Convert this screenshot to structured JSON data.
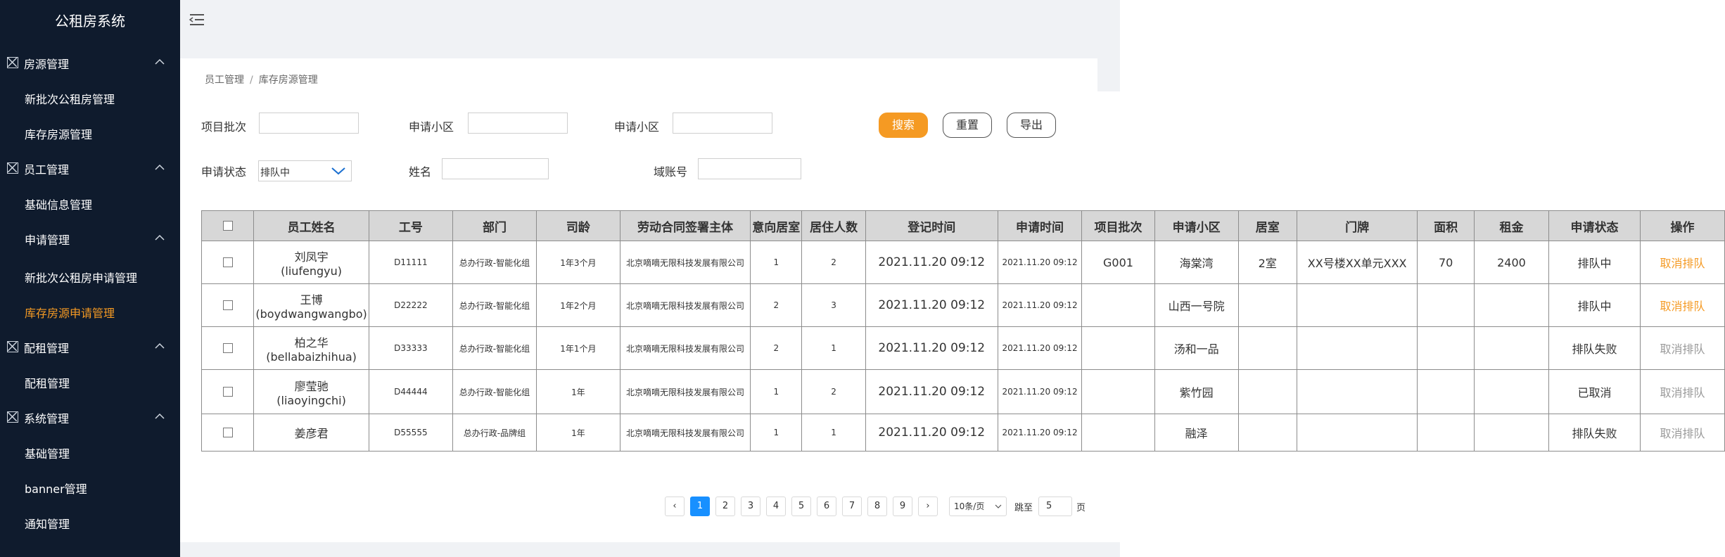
{
  "app": {
    "title": "公租房系统"
  },
  "sidebar": {
    "groups": [
      {
        "label": "房源管理",
        "items": [
          "新批次公租房管理",
          "库存房源管理"
        ]
      },
      {
        "label": "员工管理",
        "items": [
          "基础信息管理",
          "申请管理"
        ]
      },
      {
        "label": "配租管理",
        "items": [
          "配租管理"
        ]
      },
      {
        "label": "系统管理",
        "items": [
          "基础管理",
          "banner管理",
          "通知管理"
        ]
      }
    ],
    "subitems": [
      "新批次公租房申请管理",
      "库存房源申请管理"
    ],
    "active_item": "库存房源申请管理"
  },
  "breadcrumb": {
    "parent": "员工管理",
    "separator": "/",
    "current": "库存房源管理"
  },
  "filters": {
    "batch_label": "项目批次",
    "community_label_1": "申请小区",
    "community_label_2": "申请小区",
    "status_label": "申请状态",
    "status_value": "排队中",
    "name_label": "姓名",
    "domain_label": "域账号"
  },
  "buttons": {
    "search": "搜索",
    "reset": "重置",
    "export": "导出"
  },
  "table": {
    "columns": [
      "员工姓名",
      "工号",
      "部门",
      "司龄",
      "劳动合同签署主体",
      "意向居室",
      "居住人数",
      "登记时间",
      "申请时间",
      "项目批次",
      "申请小区",
      "居室",
      "门牌",
      "面积",
      "租金",
      "申请状态",
      "操作"
    ],
    "rows": [
      {
        "name": "刘凤宇",
        "pinyin": "(liufengyu)",
        "id": "D11111",
        "dept": "总办行政-智能化组",
        "tenure": "1年3个月",
        "employer": "北京嘀嘀无限科技发展有限公司",
        "rooms": "1",
        "people": "2",
        "reg_time": "2021.11.20  09:12",
        "apply_time": "2021.11.20  09:12",
        "batch": "G001",
        "community": "海棠湾",
        "room_type": "2室",
        "door": "XX号楼XX单元XXX",
        "area": "70",
        "rent": "2400",
        "status": "排队中",
        "action": "取消排队",
        "action_color": "orange"
      },
      {
        "name": "王博",
        "pinyin": "(boydwangwangbo)",
        "id": "D22222",
        "dept": "总办行政-智能化组",
        "tenure": "1年2个月",
        "employer": "北京嘀嘀无限科技发展有限公司",
        "rooms": "2",
        "people": "3",
        "reg_time": "2021.11.20  09:12",
        "apply_time": "2021.11.20  09:12",
        "batch": "",
        "community": "山西一号院",
        "room_type": "",
        "door": "",
        "area": "",
        "rent": "",
        "status": "排队中",
        "action": "取消排队",
        "action_color": "orange"
      },
      {
        "name": "柏之华",
        "pinyin": "(bellabaizhihua)",
        "id": "D33333",
        "dept": "总办行政-智能化组",
        "tenure": "1年1个月",
        "employer": "北京嘀嘀无限科技发展有限公司",
        "rooms": "2",
        "people": "1",
        "reg_time": "2021.11.20  09:12",
        "apply_time": "2021.11.20  09:12",
        "batch": "",
        "community": "汤和一品",
        "room_type": "",
        "door": "",
        "area": "",
        "rent": "",
        "status": "排队失败",
        "action": "取消排队",
        "action_color": "gray"
      },
      {
        "name": "廖莹驰",
        "pinyin": "(liaoyingchi)",
        "id": "D44444",
        "dept": "总办行政-智能化组",
        "tenure": "1年",
        "employer": "北京嘀嘀无限科技发展有限公司",
        "rooms": "1",
        "people": "2",
        "reg_time": "2021.11.20  09:12",
        "apply_time": "2021.11.20  09:12",
        "batch": "",
        "community": "紫竹园",
        "room_type": "",
        "door": "",
        "area": "",
        "rent": "",
        "status": "已取消",
        "action": "取消排队",
        "action_color": "gray"
      },
      {
        "name": "姜彦君",
        "pinyin": "",
        "id": "D55555",
        "dept": "总办行政-品牌组",
        "tenure": "1年",
        "employer": "北京嘀嘀无限科技发展有限公司",
        "rooms": "1",
        "people": "1",
        "reg_time": "2021.11.20  09:12",
        "apply_time": "2021.11.20  09:12",
        "batch": "",
        "community": "融泽",
        "room_type": "",
        "door": "",
        "area": "",
        "rent": "",
        "status": "排队失败",
        "action": "取消排队",
        "action_color": "gray"
      }
    ]
  },
  "pagination": {
    "prev": "‹",
    "next": "›",
    "pages": [
      "1",
      "2",
      "3",
      "4",
      "5",
      "6",
      "7",
      "8",
      "9"
    ],
    "current": "1",
    "page_size": "10条/页",
    "jump_label": "跳至",
    "jump_value": "5",
    "page_unit": "页"
  },
  "colors": {
    "sidebar_bg": "#0f1b2d",
    "accent": "#f59a23",
    "page_active": "#1890ff"
  }
}
